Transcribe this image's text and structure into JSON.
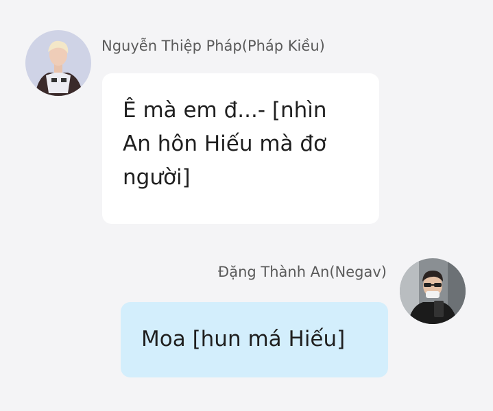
{
  "messages": [
    {
      "direction": "incoming",
      "sender_name": "Nguyễn Thiệp Pháp(Pháp Kiều)",
      "avatar_icon": "avatar-photo-icon",
      "text_lines": [
        "Ê mà em đ...- [nhìn",
        "An hôn Hiếu mà đơ",
        "người]"
      ]
    },
    {
      "direction": "outgoing",
      "sender_name": "Đặng Thành An(Negav)",
      "avatar_icon": "avatar-photo-icon",
      "text_lines": [
        "Moa [hun má Hiếu]"
      ]
    }
  ],
  "colors": {
    "background": "#f4f4f6",
    "incoming_bubble": "#ffffff",
    "outgoing_bubble": "#d3eefc",
    "name_text": "#5a5a5a"
  }
}
